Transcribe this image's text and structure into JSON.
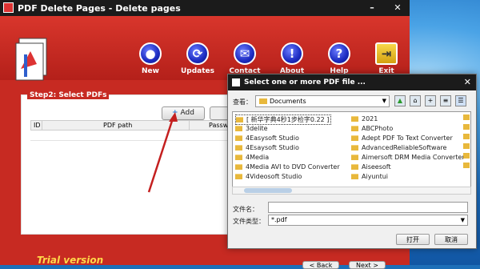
{
  "app": {
    "title": "PDF Delete Pages - Delete pages",
    "window_controls": {
      "minimize": "–",
      "close": "✕"
    },
    "toolbar": [
      {
        "label": "New",
        "icon": "new-icon",
        "glyph": "●"
      },
      {
        "label": "Updates",
        "icon": "updates-icon",
        "glyph": "⟳"
      },
      {
        "label": "Contact",
        "icon": "contact-icon",
        "glyph": "✉"
      },
      {
        "label": "About",
        "icon": "about-icon",
        "glyph": "!"
      },
      {
        "label": "Help",
        "icon": "help-icon",
        "glyph": "?"
      },
      {
        "label": "Exit",
        "icon": "exit-icon",
        "glyph": "⇥"
      }
    ],
    "step_label": "Step2: Select PDFs",
    "add_button": "Add",
    "columns": [
      "ID",
      "PDF path",
      "Passw"
    ],
    "trial_text": "Trial version",
    "back_button": "< Back",
    "next_button": "Next >",
    "colors": {
      "brand_red": "#c72a22",
      "titlebar": "#1b1b1b",
      "toolbar_icon": "#1c2bc0"
    }
  },
  "dialog": {
    "title": "Select one or more PDF file ...",
    "close": "✕",
    "look_in_label": "查看：",
    "look_in_value": "Documents",
    "files_col1": [
      "[ 新华字典4秒1步检字0.22 ]",
      "3delite",
      "4Easysoft Studio",
      "4Esaysoft Studio",
      "4Media",
      "4Media AVI to DVD Converter",
      "4Videosoft Studio"
    ],
    "files_col2": [
      "2021",
      "ABCPhoto",
      "Adept PDF To Text Converter",
      "AdvancedReliableSoftware",
      "Aimersoft DRM Media Converter",
      "Aiseesoft",
      "Aiyuntui"
    ],
    "filename_label": "文件名：",
    "filename_value": "",
    "filetype_label": "文件类型：",
    "filetype_value": "*.pdf",
    "open_button": "打开",
    "cancel_button": "取消"
  }
}
